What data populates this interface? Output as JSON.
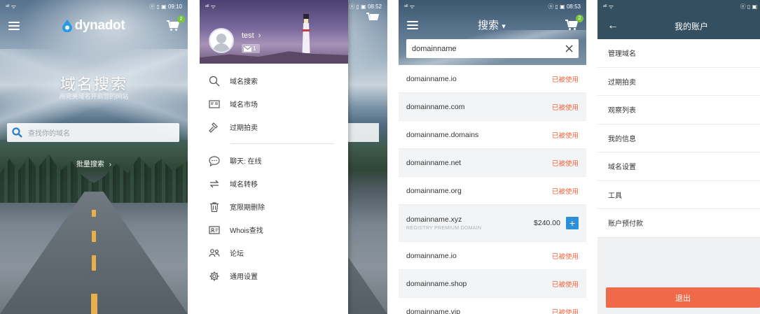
{
  "screen1": {
    "status_time": "09:10",
    "status_left": "ᵃˡˡ ᯤ",
    "status_right_icons": "ⓞ ▯ ▣",
    "logo_text": "dynadot",
    "cart_badge": "2",
    "hero_title": "域名搜索",
    "hero_subtitle": "用完美域名开启您的网站",
    "search_placeholder": "查找你的域名",
    "bulk_search": "批量搜索",
    "bulk_arrow": "›"
  },
  "screen2": {
    "status_time": "08:52",
    "username": "test",
    "user_arrow": "›",
    "mail_count": "1",
    "menu_group1": [
      {
        "label": "域名搜索",
        "icon": "search-icon"
      },
      {
        "label": "域名市场",
        "icon": "market-icon"
      },
      {
        "label": "过期拍卖",
        "icon": "gavel-icon"
      }
    ],
    "menu_group2": [
      {
        "label": "聊天: 在线",
        "icon": "chat-icon"
      },
      {
        "label": "域名转移",
        "icon": "transfer-icon"
      },
      {
        "label": "宽限期删除",
        "icon": "trash-icon"
      },
      {
        "label": "Whois查找",
        "icon": "id-card-icon"
      },
      {
        "label": "论坛",
        "icon": "forum-icon"
      },
      {
        "label": "通用设置",
        "icon": "gear-icon"
      }
    ]
  },
  "screen3": {
    "status_time": "08:53",
    "title": "搜索",
    "title_caret": "▾",
    "cart_badge": "2",
    "search_value": "domainname",
    "results": [
      {
        "domain": "domainname.io",
        "status": "已被使用"
      },
      {
        "domain": "domainname.com",
        "status": "已被使用"
      },
      {
        "domain": "domainname.domains",
        "status": "已被使用"
      },
      {
        "domain": "domainname.net",
        "status": "已被使用"
      },
      {
        "domain": "domainname.org",
        "status": "已被使用"
      }
    ],
    "premium": {
      "domain": "domainname.xyz",
      "sub": "REGISTRY PREMIUM DOMAIN",
      "price": "$240.00",
      "add": "+"
    },
    "results2": [
      {
        "domain": "domainname.io",
        "status": "已被使用"
      },
      {
        "domain": "domainname.shop",
        "status": "已被使用"
      },
      {
        "domain": "domainname.vip",
        "status": "已被使用"
      }
    ]
  },
  "screen4": {
    "status_right_icons": "ⓞ ▯ ▣",
    "title": "我的账户",
    "back": "←",
    "items": [
      "管理域名",
      "过期拍卖",
      "观察列表",
      "我的信息",
      "域名设置",
      "工具",
      "账户预付款"
    ],
    "logout": "退出"
  },
  "colors": {
    "taken": "#f0653f",
    "accent_blue": "#2d8fd8",
    "badge_green": "#7cc243",
    "logout": "#f06a4a",
    "header_dark": "#344f5f"
  }
}
